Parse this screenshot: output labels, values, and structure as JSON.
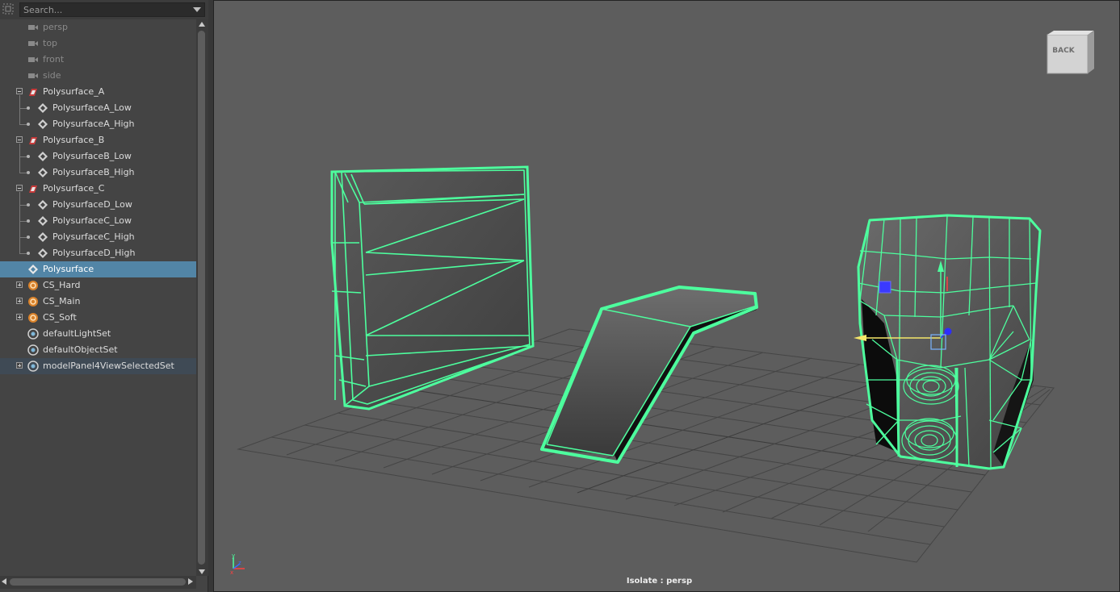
{
  "search": {
    "placeholder": "Search..."
  },
  "outliner": {
    "items": [
      {
        "label": "persp",
        "icon": "camera-icon",
        "dim": true
      },
      {
        "label": "top",
        "icon": "camera-icon",
        "dim": true
      },
      {
        "label": "front",
        "icon": "camera-icon",
        "dim": true
      },
      {
        "label": "side",
        "icon": "camera-icon",
        "dim": true
      },
      {
        "label": "Polysurface_A",
        "icon": "group-icon"
      },
      {
        "label": "PolysurfaceA_Low",
        "icon": "mesh-icon"
      },
      {
        "label": "PolysurfaceA_High",
        "icon": "mesh-icon"
      },
      {
        "label": "Polysurface_B",
        "icon": "group-icon"
      },
      {
        "label": "PolysurfaceB_Low",
        "icon": "mesh-icon"
      },
      {
        "label": "PolysurfaceB_High",
        "icon": "mesh-icon"
      },
      {
        "label": "Polysurface_C",
        "icon": "group-icon"
      },
      {
        "label": "PolysurfaceD_Low",
        "icon": "mesh-icon"
      },
      {
        "label": "PolysurfaceC_Low",
        "icon": "mesh-icon"
      },
      {
        "label": "PolysurfaceC_High",
        "icon": "mesh-icon"
      },
      {
        "label": "PolysurfaceD_High",
        "icon": "mesh-icon"
      },
      {
        "label": "Polysurface",
        "icon": "mesh-icon",
        "selected": true
      },
      {
        "label": "CS_Hard",
        "icon": "cage-set-icon"
      },
      {
        "label": "CS_Main",
        "icon": "cage-set-icon"
      },
      {
        "label": "CS_Soft",
        "icon": "cage-set-icon"
      },
      {
        "label": "defaultLightSet",
        "icon": "set-icon"
      },
      {
        "label": "defaultObjectSet",
        "icon": "set-icon"
      },
      {
        "label": "modelPanel4ViewSelectedSet",
        "icon": "set-icon",
        "highlighted": true
      }
    ]
  },
  "viewport": {
    "viewcube_label": "BACK",
    "status": "Isolate : persp",
    "axes": {
      "x": "x",
      "y": "y",
      "z": "z"
    },
    "wire_color": "#4dff9e",
    "background_color": "#5d5d5d"
  }
}
